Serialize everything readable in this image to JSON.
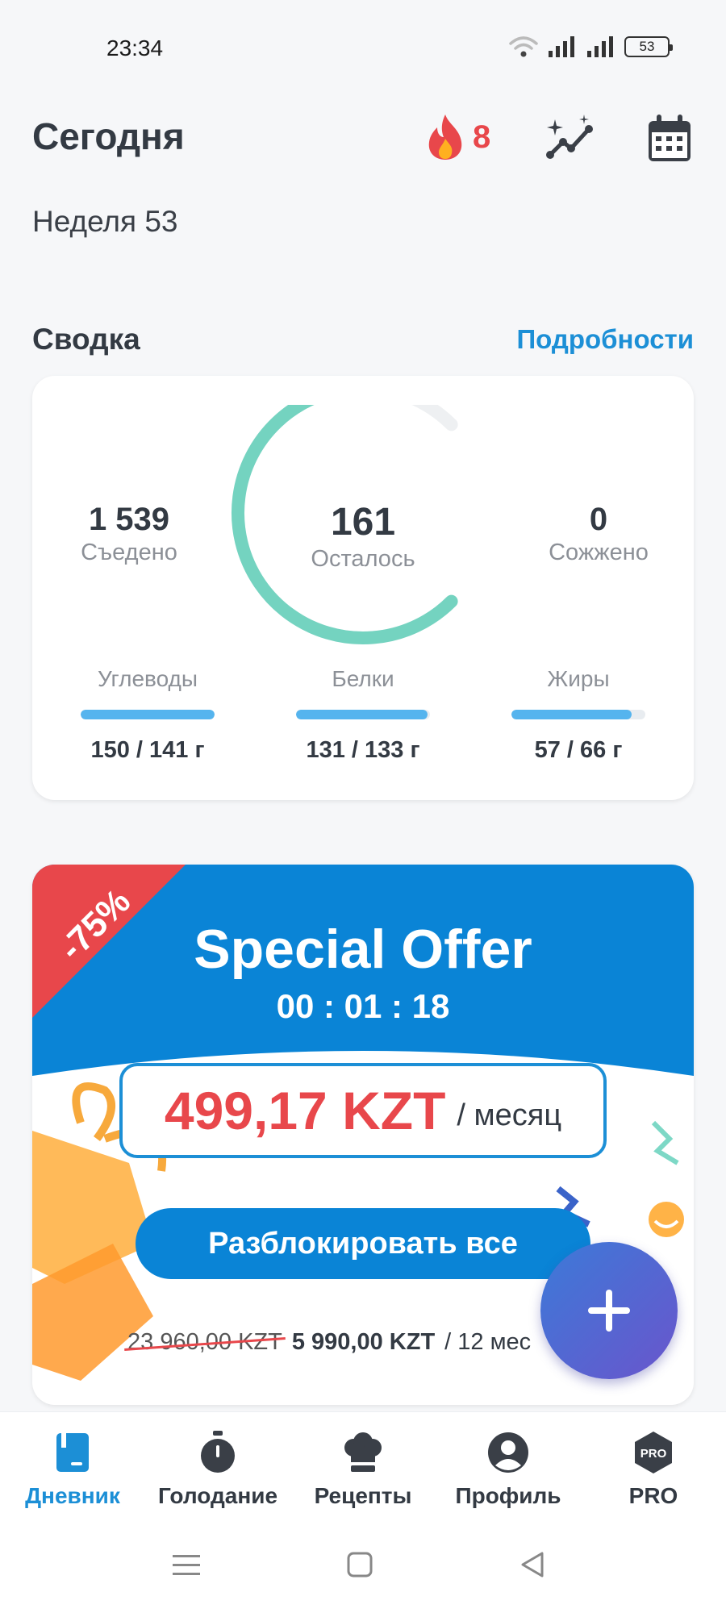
{
  "status_bar": {
    "time": "23:34",
    "battery": "53"
  },
  "header": {
    "title": "Сегодня",
    "week": "Неделя 53",
    "streak_count": "8"
  },
  "summary": {
    "title": "Сводка",
    "details_link": "Подробности",
    "eaten": {
      "value": "1 539",
      "label": "Съедено"
    },
    "remaining": {
      "value": "161",
      "label": "Осталось",
      "progress": 0.9
    },
    "burned": {
      "value": "0",
      "label": "Сожжено"
    },
    "macros": [
      {
        "name": "Углеводы",
        "amount": "150 / 141 г",
        "fill": 1.0
      },
      {
        "name": "Белки",
        "amount": "131 / 133 г",
        "fill": 0.98
      },
      {
        "name": "Жиры",
        "amount": "57 / 66 г",
        "fill": 0.9
      }
    ]
  },
  "offer": {
    "discount": "-75%",
    "title": "Special Offer",
    "timer": "00 : 01 : 18",
    "price": "499,17 KZT",
    "period": "/ месяц",
    "unlock_button": "Разблокировать все",
    "old_price": "23 960,00 KZT",
    "new_price": "5 990,00 KZT",
    "annual_period": "/ 12 мес"
  },
  "bottom_nav": {
    "items": [
      {
        "label": "Дневник"
      },
      {
        "label": "Голодание"
      },
      {
        "label": "Рецепты"
      },
      {
        "label": "Профиль"
      },
      {
        "label": "PRO"
      }
    ],
    "pro_badge": "PRO"
  },
  "colors": {
    "accent": "#1c8fd6",
    "gauge": "#74d3c0",
    "red": "#e8474b",
    "macro_bar": "#55b4ee"
  }
}
